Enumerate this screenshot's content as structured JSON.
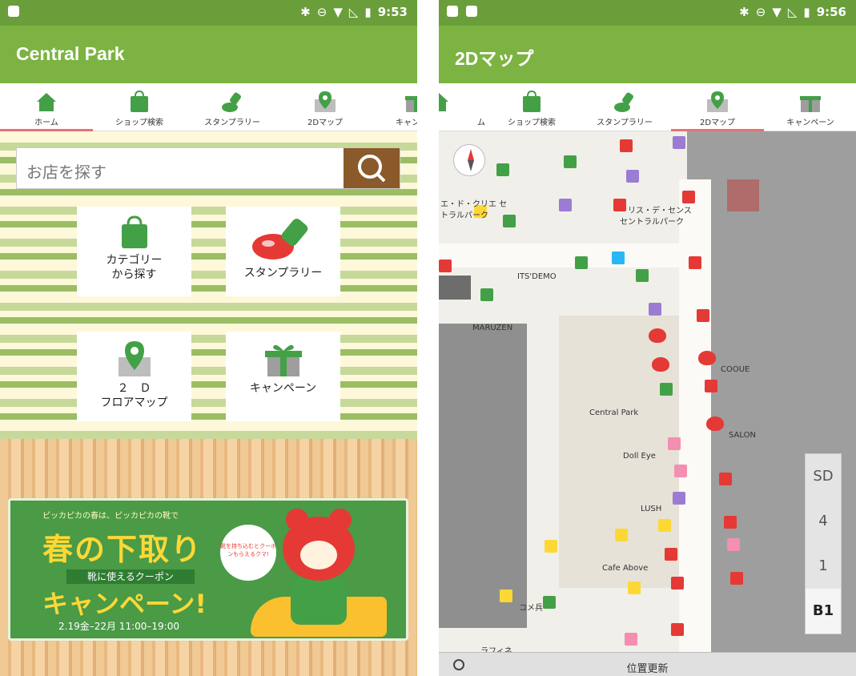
{
  "left": {
    "status": {
      "time": "9:53"
    },
    "app_title": "Central Park",
    "tabs": [
      {
        "label": "ホーム",
        "icon": "home-icon",
        "active": true
      },
      {
        "label": "ショップ検索",
        "icon": "shopping-bag-icon"
      },
      {
        "label": "スタンプラリー",
        "icon": "stamp-icon"
      },
      {
        "label": "2Dマップ",
        "icon": "map-pin-icon"
      },
      {
        "label": "キャン",
        "icon": "gift-icon"
      }
    ],
    "search": {
      "placeholder": "お店を探す"
    },
    "tiles": [
      {
        "label": "カテゴリー\nから探す",
        "icon": "shopping-bag-icon"
      },
      {
        "label": "スタンプラリー",
        "icon": "stamp-icon"
      },
      {
        "label": "２　Ｄ\nフロアマップ",
        "icon": "map-pin-icon"
      },
      {
        "label": "キャンペーン",
        "icon": "gift-icon"
      }
    ],
    "banner": {
      "small_text": "ピッカピカの春は、ピッカピカの靴で",
      "title": "春の下取り",
      "subtitle": "靴に使えるクーポン",
      "campaign": "キャンペーン!",
      "date": "2.19金–22月 11:00–19:00",
      "bubble_text": "靴を持ち込むとクーポンもらえるクマ!"
    }
  },
  "right": {
    "status": {
      "time": "9:56"
    },
    "app_title": "2Dマップ",
    "tabs": [
      {
        "label": "ム",
        "icon": "home-icon"
      },
      {
        "label": "ショップ検索",
        "icon": "shopping-bag-icon"
      },
      {
        "label": "スタンプラリー",
        "icon": "stamp-icon"
      },
      {
        "label": "2Dマップ",
        "icon": "map-pin-icon",
        "active": true
      },
      {
        "label": "キャンペーン",
        "icon": "gift-icon"
      }
    ],
    "map_labels": {
      "a": "エ・ド・クリエ セ",
      "b": "トラルパーク",
      "c": "リス・デ・センス",
      "d": "セントラルパーク",
      "e": "ITS'DEMO",
      "f": "MARUZEN",
      "g": "Central Park",
      "h": "Doll Eye",
      "i": "LUSH",
      "j": "Cafe Above",
      "k": "コメ兵",
      "l": "ラフィネ",
      "m": "COOUE",
      "n": "SALON"
    },
    "floors": [
      "SD",
      "4",
      "1",
      "B1"
    ],
    "active_floor": "B1",
    "bottom_button": "位置更新"
  },
  "colors": {
    "status_bar": "#6a9e3a",
    "app_bar": "#7cb342",
    "tab_indicator": "#e57373",
    "search_button": "#8a5a2b"
  }
}
